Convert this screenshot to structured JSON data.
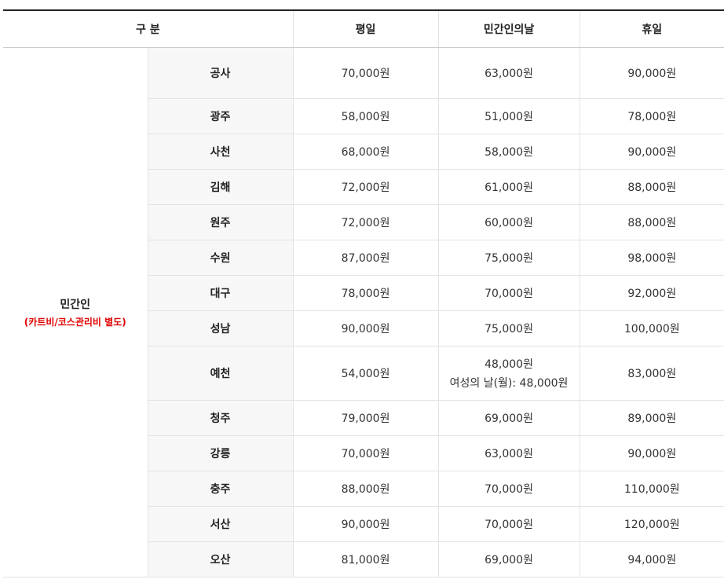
{
  "header": {
    "division": "구 분",
    "weekday": "평일",
    "civilian_day": "민간인의날",
    "holiday": "휴일"
  },
  "category": {
    "title": "민간인",
    "note": "(카트비/코스관리비 별도)"
  },
  "rows": [
    {
      "region": "공사",
      "weekday": "70,000원",
      "civilian_day": "63,000원",
      "civilian_day_note": "",
      "holiday": "90,000원"
    },
    {
      "region": "광주",
      "weekday": "58,000원",
      "civilian_day": "51,000원",
      "civilian_day_note": "",
      "holiday": "78,000원"
    },
    {
      "region": "사천",
      "weekday": "68,000원",
      "civilian_day": "58,000원",
      "civilian_day_note": "",
      "holiday": "90,000원"
    },
    {
      "region": "김해",
      "weekday": "72,000원",
      "civilian_day": "61,000원",
      "civilian_day_note": "",
      "holiday": "88,000원"
    },
    {
      "region": "원주",
      "weekday": "72,000원",
      "civilian_day": "60,000원",
      "civilian_day_note": "",
      "holiday": "88,000원"
    },
    {
      "region": "수원",
      "weekday": "87,000원",
      "civilian_day": "75,000원",
      "civilian_day_note": "",
      "holiday": "98,000원"
    },
    {
      "region": "대구",
      "weekday": "78,000원",
      "civilian_day": "70,000원",
      "civilian_day_note": "",
      "holiday": "92,000원"
    },
    {
      "region": "성남",
      "weekday": "90,000원",
      "civilian_day": "75,000원",
      "civilian_day_note": "",
      "holiday": "100,000원"
    },
    {
      "region": "예천",
      "weekday": "54,000원",
      "civilian_day": "48,000원",
      "civilian_day_note": "여성의 날(월): 48,000원",
      "holiday": "83,000원"
    },
    {
      "region": "청주",
      "weekday": "79,000원",
      "civilian_day": "69,000원",
      "civilian_day_note": "",
      "holiday": "89,000원"
    },
    {
      "region": "강릉",
      "weekday": "70,000원",
      "civilian_day": "63,000원",
      "civilian_day_note": "",
      "holiday": "90,000원"
    },
    {
      "region": "충주",
      "weekday": "88,000원",
      "civilian_day": "70,000원",
      "civilian_day_note": "",
      "holiday": "110,000원"
    },
    {
      "region": "서산",
      "weekday": "90,000원",
      "civilian_day": "70,000원",
      "civilian_day_note": "",
      "holiday": "120,000원"
    },
    {
      "region": "오산",
      "weekday": "81,000원",
      "civilian_day": "69,000원",
      "civilian_day_note": "",
      "holiday": "94,000원"
    }
  ]
}
